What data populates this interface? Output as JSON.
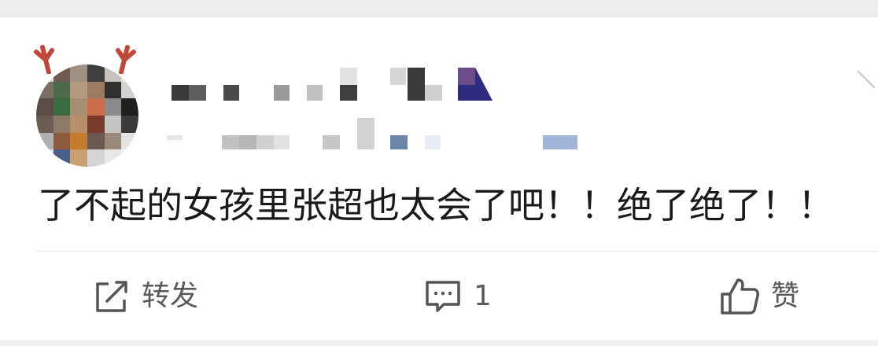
{
  "post": {
    "text": "了不起的女孩里张超也太会了吧！！绝了绝了！！"
  },
  "actions": {
    "repost_label": "转发",
    "comment_count": "1",
    "like_label": "赞"
  },
  "icons": {
    "repost": "share-icon",
    "comment": "comment-icon",
    "like": "thumbs-up-icon",
    "menu": "chevron-down-icon"
  },
  "colors": {
    "text": "#1a1a1a",
    "action_text": "#5a5a5a",
    "divider": "#e6e6e6"
  }
}
